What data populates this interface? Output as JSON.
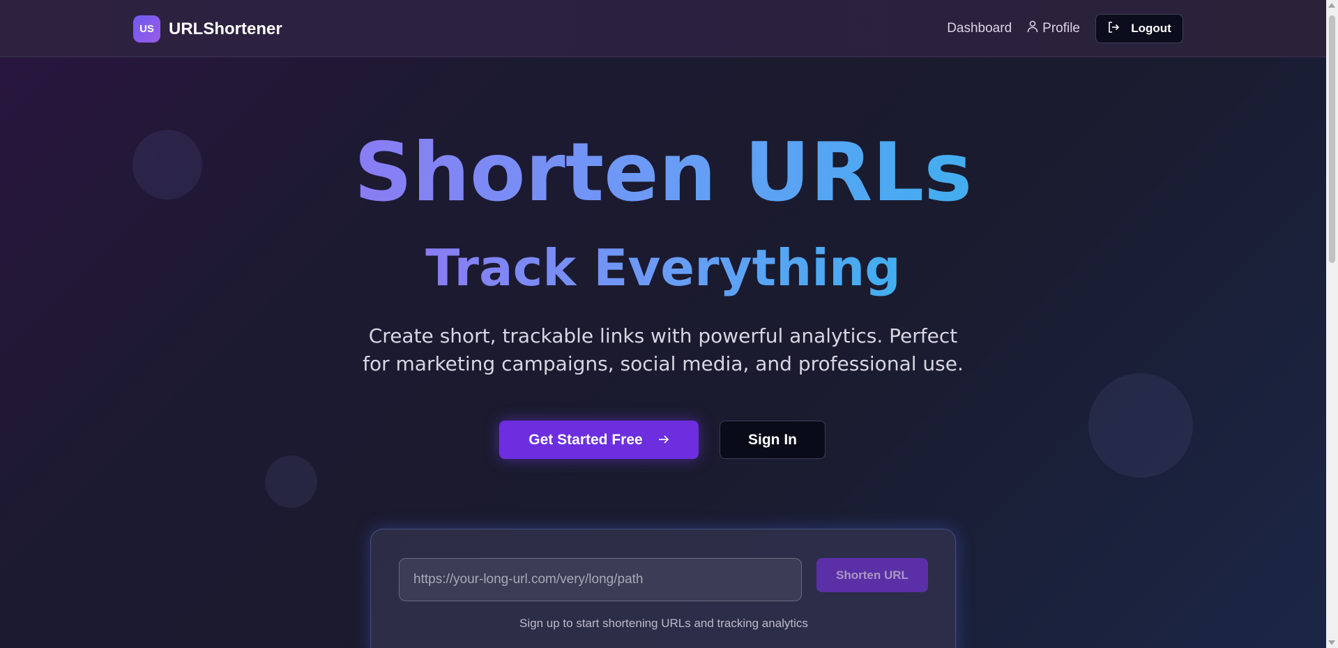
{
  "navbar": {
    "logo_text": "US",
    "brand_name": "URLShortener",
    "dashboard_label": "Dashboard",
    "profile_label": "Profile",
    "logout_label": "Logout"
  },
  "hero": {
    "title": "Shorten URLs",
    "subtitle": "Track Everything",
    "description": "Create short, trackable links with powerful analytics. Perfect for marketing campaigns, social media, and professional use.",
    "primary_cta": "Get Started Free",
    "secondary_cta": "Sign In"
  },
  "shortener": {
    "url_placeholder": "https://your-long-url.com/very/long/path",
    "url_value": "",
    "button_label": "Shorten URL",
    "note": "Sign up to start shortening URLs and tracking analytics"
  },
  "colors": {
    "accent": "#6d2ee0",
    "gradient_start": "#8a7cf4",
    "gradient_end": "#42aef0"
  },
  "icons": {
    "profile": "user-icon",
    "logout": "logout-icon",
    "cta_arrow": "arrow-right-icon"
  }
}
